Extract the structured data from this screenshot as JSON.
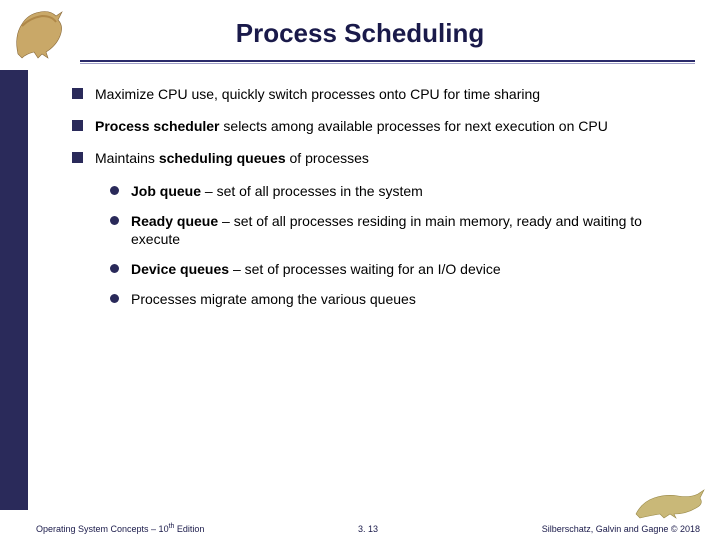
{
  "title": "Process Scheduling",
  "bullets": {
    "b1": "Maximize CPU use, quickly switch processes onto CPU for time sharing",
    "b2a": "Process scheduler",
    "b2b": " selects among available processes for next execution on CPU",
    "b3a": "Maintains ",
    "b3b": "scheduling queues",
    "b3c": " of processes",
    "s1a": "Job queue",
    "s1b": " – set of all processes in the system",
    "s2a": "Ready queue",
    "s2b": " – set of all processes residing in main memory, ready and waiting to execute",
    "s3a": "Device queues",
    "s3b": " – set of processes waiting for an I/O device",
    "s4": "Processes migrate among the various queues"
  },
  "footer": {
    "left_a": "Operating System Concepts – 10",
    "left_b": " Edition",
    "left_sup": "th",
    "center": "3. 13",
    "right": "Silberschatz, Galvin and Gagne © 2018"
  }
}
